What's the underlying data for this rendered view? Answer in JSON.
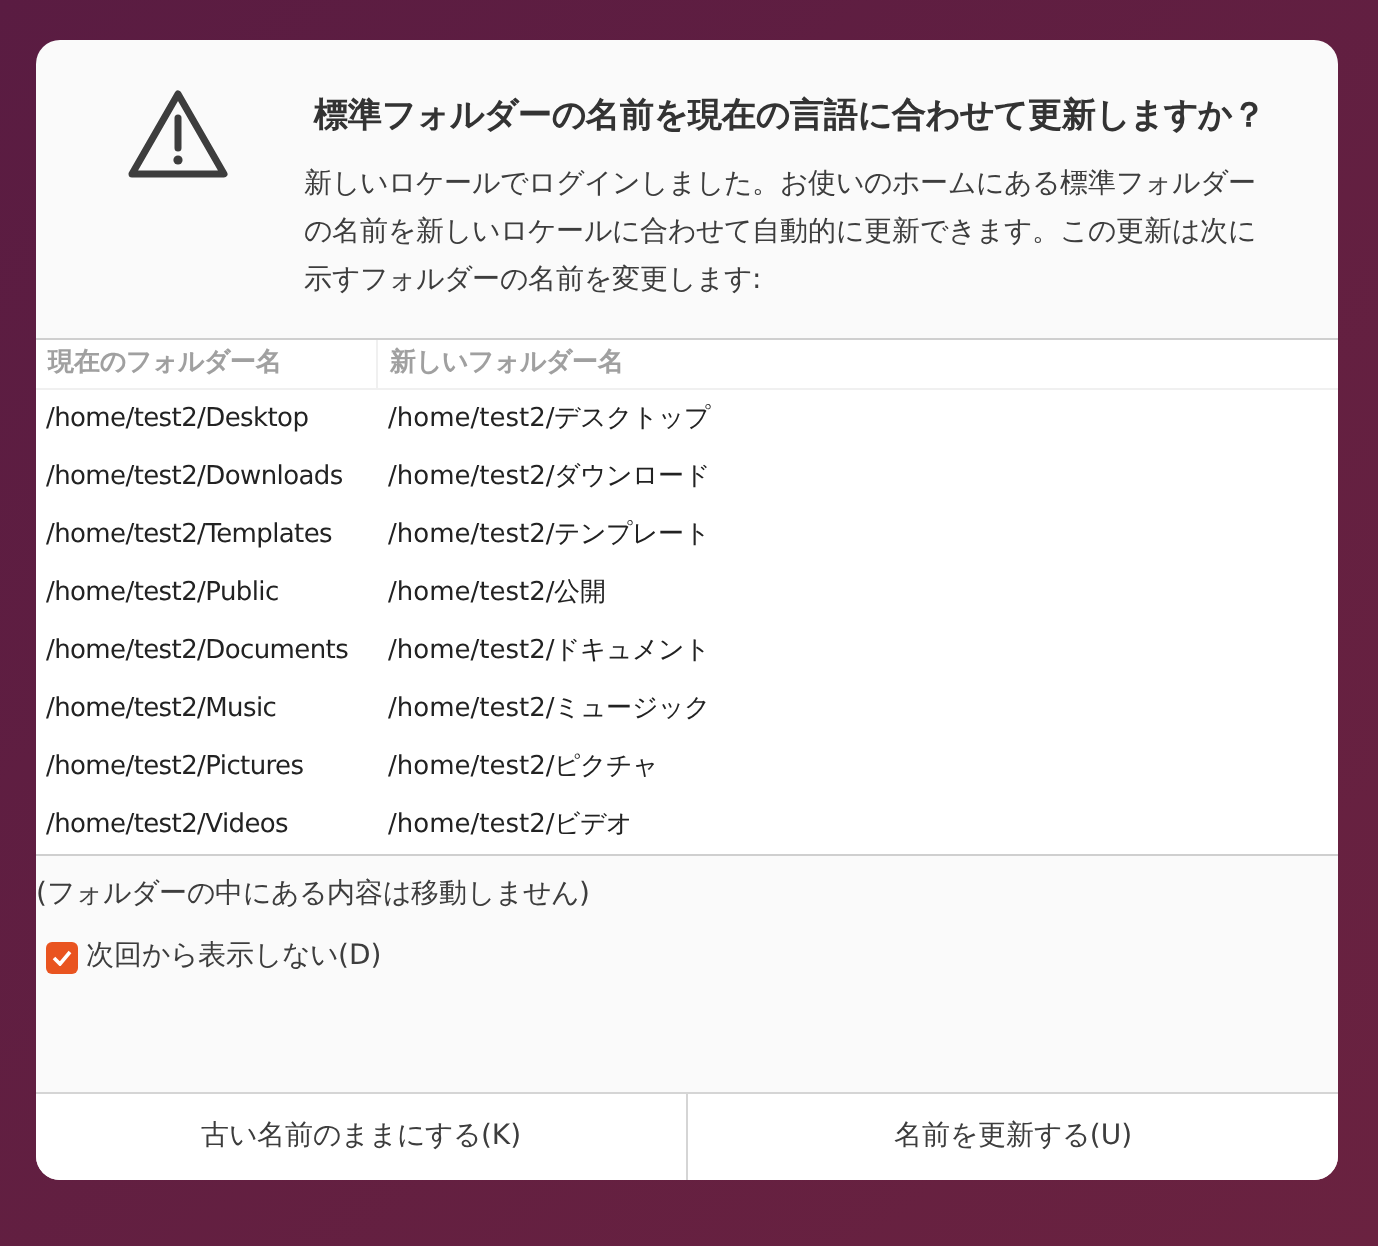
{
  "dialog": {
    "title": "標準フォルダーの名前を現在の言語に合わせて更新しますか？",
    "message": "新しいロケールでログインしました。お使いのホームにある標準フォルダーの名前を新しいロケールに合わせて自動的に更新できます。この更新は次に示すフォルダーの名前を変更します:",
    "table": {
      "columns": [
        "現在のフォルダー名",
        "新しいフォルダー名"
      ],
      "rows": [
        [
          "/home/test2/Desktop",
          "/home/test2/デスクトップ"
        ],
        [
          "/home/test2/Downloads",
          "/home/test2/ダウンロード"
        ],
        [
          "/home/test2/Templates",
          "/home/test2/テンプレート"
        ],
        [
          "/home/test2/Public",
          "/home/test2/公開"
        ],
        [
          "/home/test2/Documents",
          "/home/test2/ドキュメント"
        ],
        [
          "/home/test2/Music",
          "/home/test2/ミュージック"
        ],
        [
          "/home/test2/Pictures",
          "/home/test2/ピクチャ"
        ],
        [
          "/home/test2/Videos",
          "/home/test2/ビデオ"
        ]
      ]
    },
    "note": "(フォルダーの中にある内容は移動しません)",
    "checkbox": {
      "label": "次回から表示しない(D)",
      "checked": true
    },
    "buttons": [
      "古い名前のままにする(K)",
      "名前を更新する(U)"
    ]
  }
}
